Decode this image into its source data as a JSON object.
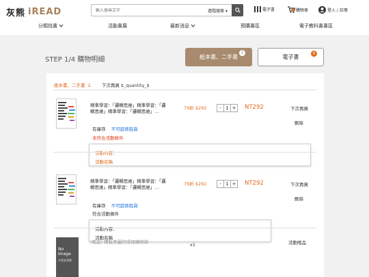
{
  "header": {
    "logo_zh": "灰熊",
    "logo_en": "iREAD",
    "search_placeholder": "輸入搜尋文字",
    "advanced_search": "進階搜索",
    "nav": {
      "ebook": "電子書",
      "cart": "購物車",
      "login": "登入 / 註冊"
    }
  },
  "menu": [
    "分類找書",
    "活動書展",
    "最新消息",
    "預購專區",
    "電子教科書專區"
  ],
  "step": "STEP 1/4 購物明細",
  "tabs": {
    "paper": {
      "label": "紙本書、二手書",
      "count": "3"
    },
    "ebook": {
      "label": "電子書",
      "count": "0"
    }
  },
  "panel": {
    "section_label": "紙本書、二手書",
    "section_count": "2",
    "quantity_label": "下次再買 $_quantity_$",
    "items": [
      {
        "title": "精準學習：「邏輯思維」精準學習：「邏輯思維」精準學習：「邏輯思維」…",
        "discount": "79折",
        "price": "$292",
        "qty": "1",
        "total": "NT292",
        "buy_later": "下次再買",
        "delete": "刪除",
        "stock": "有庫存",
        "no_over": "不可超商取貨",
        "promo_status": "未符合活動條件",
        "popup_title": "活動內容：",
        "popup_name": "活動名稱"
      },
      {
        "title": "精準學習：「邏輯思維」精準學習：「邏輯思維」精準學習：「邏輯思維」…",
        "discount": "79折",
        "price": "$292",
        "qty": "1",
        "total": "NT292",
        "buy_later": "下次再買",
        "delete": "刪除",
        "stock": "有庫存",
        "no_over": "不可超商取貨",
        "promo_status": "符合活動條件",
        "popup_title": "活動內容：",
        "popup_name": "活動名稱"
      }
    ],
    "gift": {
      "cover_text": "No Image",
      "cover_sub": "灰熊愛讀書",
      "title": "(贈品) 精裝美麗的環保購物袋",
      "qty": "x1",
      "label": "活動贈品"
    }
  },
  "colors": {
    "accent": "#a88a6e",
    "orange": "#e06a1b",
    "link": "#1e6fd9"
  }
}
